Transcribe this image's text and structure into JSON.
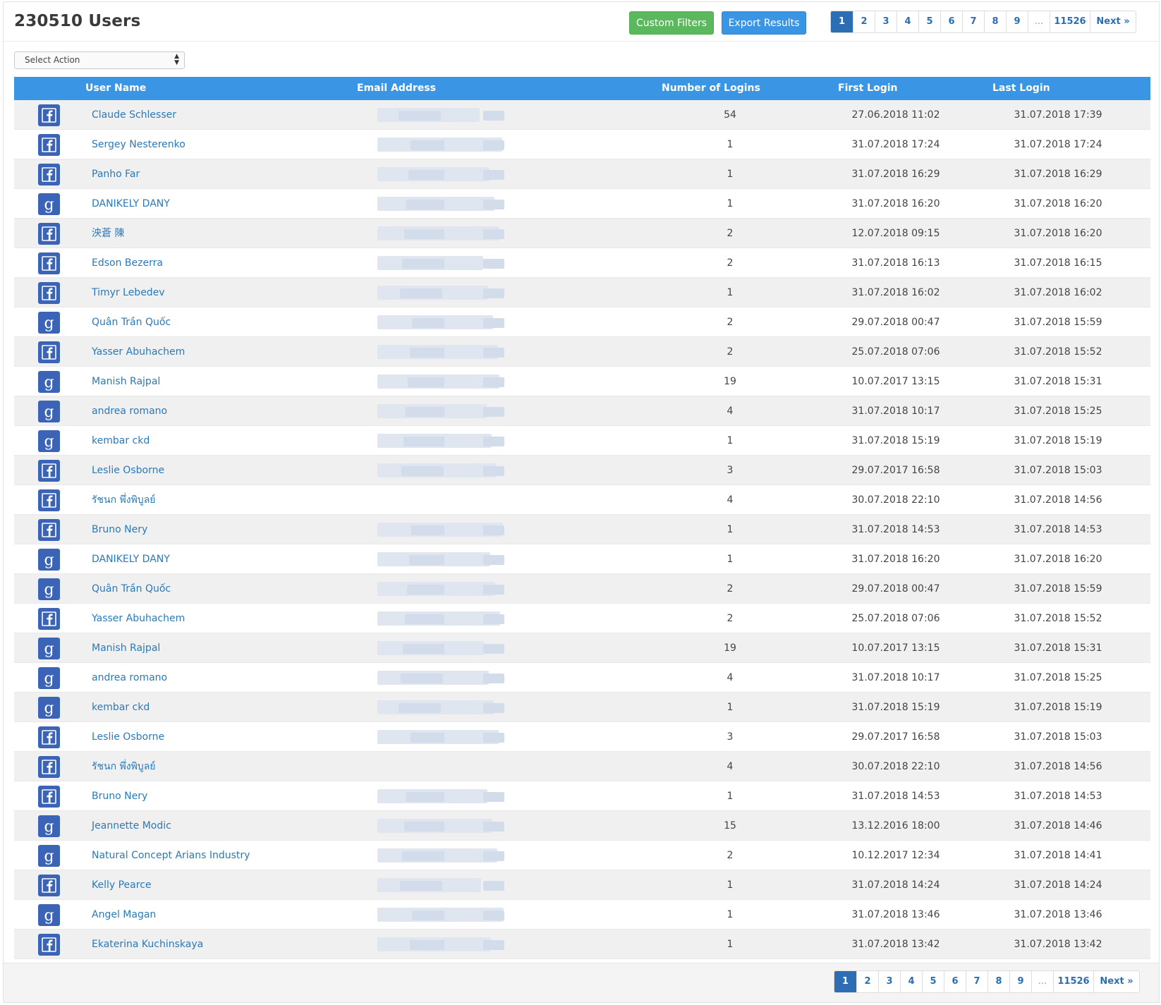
{
  "header": {
    "title": "230510 Users"
  },
  "toolbar": {
    "custom_filters_label": "Custom Filters",
    "export_results_label": "Export Results"
  },
  "pagination": {
    "pages": [
      "1",
      "2",
      "3",
      "4",
      "5",
      "6",
      "7",
      "8",
      "9",
      "...",
      "11526",
      "Next »"
    ],
    "active": "1"
  },
  "bulk_action": {
    "selected": "Select Action"
  },
  "table": {
    "columns": {
      "user_name": "User Name",
      "email": "Email Address",
      "logins": "Number of Logins",
      "first_login": "First Login",
      "last_login": "Last Login"
    },
    "rows": [
      {
        "provider": "facebook",
        "name": "Claude Schlesser",
        "logins": "54",
        "first": "27.06.2018 11:02",
        "last": "31.07.2018 17:39"
      },
      {
        "provider": "facebook",
        "name": "Sergey Nesterenko",
        "logins": "1",
        "first": "31.07.2018 17:24",
        "last": "31.07.2018 17:24"
      },
      {
        "provider": "facebook",
        "name": "Panho Far",
        "logins": "1",
        "first": "31.07.2018 16:29",
        "last": "31.07.2018 16:29"
      },
      {
        "provider": "google",
        "name": "DANIKELY DANY",
        "logins": "1",
        "first": "31.07.2018 16:20",
        "last": "31.07.2018 16:20"
      },
      {
        "provider": "facebook",
        "name": "泱蒼 陳",
        "logins": "2",
        "first": "12.07.2018 09:15",
        "last": "31.07.2018 16:20"
      },
      {
        "provider": "facebook",
        "name": "Edson Bezerra",
        "logins": "2",
        "first": "31.07.2018 16:13",
        "last": "31.07.2018 16:15"
      },
      {
        "provider": "facebook",
        "name": "Timyr Lebedev",
        "logins": "1",
        "first": "31.07.2018 16:02",
        "last": "31.07.2018 16:02"
      },
      {
        "provider": "google",
        "name": "Quân Trần Quốc",
        "logins": "2",
        "first": "29.07.2018 00:47",
        "last": "31.07.2018 15:59"
      },
      {
        "provider": "facebook",
        "name": "Yasser Abuhachem",
        "logins": "2",
        "first": "25.07.2018 07:06",
        "last": "31.07.2018 15:52"
      },
      {
        "provider": "google",
        "name": "Manish Rajpal",
        "logins": "19",
        "first": "10.07.2017 13:15",
        "last": "31.07.2018 15:31"
      },
      {
        "provider": "google",
        "name": "andrea romano",
        "logins": "4",
        "first": "31.07.2018 10:17",
        "last": "31.07.2018 15:25"
      },
      {
        "provider": "google",
        "name": "kembar ckd",
        "logins": "1",
        "first": "31.07.2018 15:19",
        "last": "31.07.2018 15:19"
      },
      {
        "provider": "facebook",
        "name": "Leslie Osborne",
        "logins": "3",
        "first": "29.07.2017 16:58",
        "last": "31.07.2018 15:03"
      },
      {
        "provider": "facebook",
        "name": "รัชนก พึ่งพิบูลย์",
        "logins": "4",
        "first": "30.07.2018 22:10",
        "last": "31.07.2018 14:56"
      },
      {
        "provider": "facebook",
        "name": "Bruno Nery",
        "logins": "1",
        "first": "31.07.2018 14:53",
        "last": "31.07.2018 14:53"
      },
      {
        "provider": "google",
        "name": "DANIKELY DANY",
        "logins": "1",
        "first": "31.07.2018 16:20",
        "last": "31.07.2018 16:20"
      },
      {
        "provider": "google",
        "name": "Quân Trần Quốc",
        "logins": "2",
        "first": "29.07.2018 00:47",
        "last": "31.07.2018 15:59"
      },
      {
        "provider": "facebook",
        "name": "Yasser Abuhachem",
        "logins": "2",
        "first": "25.07.2018 07:06",
        "last": "31.07.2018 15:52"
      },
      {
        "provider": "google",
        "name": "Manish Rajpal",
        "logins": "19",
        "first": "10.07.2017 13:15",
        "last": "31.07.2018 15:31"
      },
      {
        "provider": "google",
        "name": "andrea romano",
        "logins": "4",
        "first": "31.07.2018 10:17",
        "last": "31.07.2018 15:25"
      },
      {
        "provider": "google",
        "name": "kembar ckd",
        "logins": "1",
        "first": "31.07.2018 15:19",
        "last": "31.07.2018 15:19"
      },
      {
        "provider": "facebook",
        "name": "Leslie Osborne",
        "logins": "3",
        "first": "29.07.2017 16:58",
        "last": "31.07.2018 15:03"
      },
      {
        "provider": "facebook",
        "name": "รัชนก พึ่งพิบูลย์",
        "logins": "4",
        "first": "30.07.2018 22:10",
        "last": "31.07.2018 14:56"
      },
      {
        "provider": "facebook",
        "name": "Bruno Nery",
        "logins": "1",
        "first": "31.07.2018 14:53",
        "last": "31.07.2018 14:53"
      },
      {
        "provider": "google",
        "name": "Jeannette Modic",
        "logins": "15",
        "first": "13.12.2016 18:00",
        "last": "31.07.2018 14:46"
      },
      {
        "provider": "google",
        "name": "Natural Concept Arians Industry",
        "logins": "2",
        "first": "10.12.2017 12:34",
        "last": "31.07.2018 14:41"
      },
      {
        "provider": "facebook",
        "name": "Kelly Pearce",
        "logins": "1",
        "first": "31.07.2018 14:24",
        "last": "31.07.2018 14:24"
      },
      {
        "provider": "google",
        "name": "Angel Magan",
        "logins": "1",
        "first": "31.07.2018 13:46",
        "last": "31.07.2018 13:46"
      },
      {
        "provider": "facebook",
        "name": "Ekaterina Kuchinskaya",
        "logins": "1",
        "first": "31.07.2018 13:42",
        "last": "31.07.2018 13:42"
      }
    ]
  },
  "colors": {
    "header_blue": "#3a96e4",
    "green_button": "#5cb85c",
    "link": "#2a79b9",
    "active_page": "#2c6db3",
    "provider_icon": "#3b64b6"
  }
}
